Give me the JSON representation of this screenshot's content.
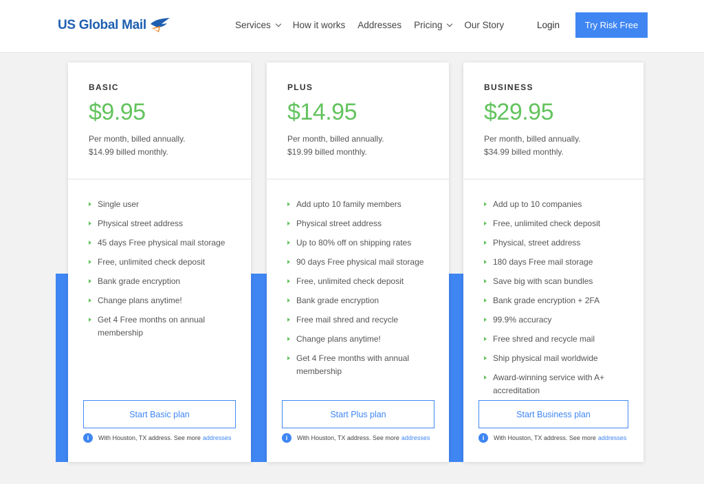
{
  "header": {
    "logo_text": "US Global Mail",
    "nav": [
      {
        "label": "Services",
        "has_dropdown": true
      },
      {
        "label": "How it works",
        "has_dropdown": false
      },
      {
        "label": "Addresses",
        "has_dropdown": false
      },
      {
        "label": "Pricing",
        "has_dropdown": true
      },
      {
        "label": "Our Story",
        "has_dropdown": false
      }
    ],
    "login_label": "Login",
    "cta_label": "Try Risk Free"
  },
  "plans": [
    {
      "name": "BASIC",
      "price": "$9.95",
      "billing_line1": "Per month, billed annually.",
      "billing_line2": "$14.99 billed monthly.",
      "features": [
        "Single user",
        "Physical street address",
        "45 days Free physical mail storage",
        "Free, unlimited check deposit",
        "Bank grade encryption",
        "Change plans anytime!",
        "Get 4 Free months on annual membership"
      ],
      "button_label": "Start Basic plan",
      "note_text": "With Houston, TX address. See more",
      "note_link": "addresses"
    },
    {
      "name": "PLUS",
      "price": "$14.95",
      "billing_line1": "Per month, billed annually.",
      "billing_line2": "$19.99 billed monthly.",
      "features": [
        "Add upto 10 family members",
        "Physical street address",
        "Up to 80% off on shipping rates",
        "90 days Free physical mail storage",
        "Free, unlimited check deposit",
        "Bank grade encryption",
        "Free mail shred and recycle",
        "Change plans anytime!",
        "Get 4 Free months with annual membership"
      ],
      "button_label": "Start Plus plan",
      "note_text": "With Houston, TX address. See more",
      "note_link": "addresses"
    },
    {
      "name": "BUSINESS",
      "price": "$29.95",
      "billing_line1": "Per month, billed annually.",
      "billing_line2": "$34.99 billed monthly.",
      "features": [
        "Add up to 10 companies",
        "Free, unlimited check deposit",
        "Physical, street address",
        "180 days Free mail storage",
        "Save big with scan bundles",
        "Bank grade encryption + 2FA",
        "99.9% accuracy",
        "Free shred and recycle mail",
        "Ship physical mail worldwide",
        "Award-winning service with A+ accreditation"
      ],
      "button_label": "Start Business plan",
      "note_text": "With Houston, TX address. See more",
      "note_link": "addresses"
    }
  ],
  "colors": {
    "accent_blue": "#3f86f3",
    "price_green": "#63c35e",
    "logo_blue": "#1f5fb0",
    "logo_orange": "#f08a24"
  },
  "icons": {
    "info": "i"
  }
}
